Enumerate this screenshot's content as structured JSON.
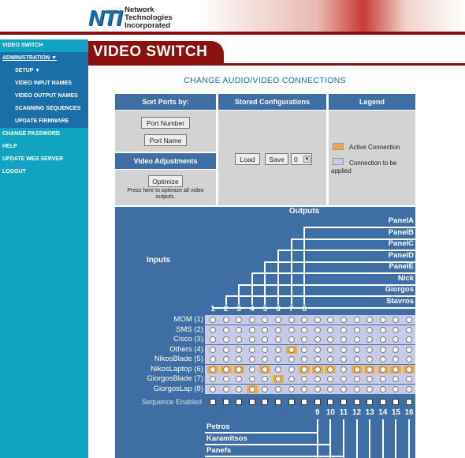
{
  "brand": {
    "logo": "NTI",
    "line1": "Network",
    "line2": "Technologies",
    "line3": "Incorporated"
  },
  "nav": [
    {
      "label": "VIDEO SWITCH",
      "type": "top"
    },
    {
      "label": "ADMINISTRATION ▼",
      "type": "admin"
    },
    {
      "label": "SETUP ▼",
      "type": "sub"
    },
    {
      "label": "VIDEO INPUT NAMES",
      "type": "sub"
    },
    {
      "label": "VIDEO OUTPUT NAMES",
      "type": "sub"
    },
    {
      "label": "SCANNING SEQUENCES",
      "type": "sub"
    },
    {
      "label": "UPDATE FIRMWARE",
      "type": "sub"
    },
    {
      "label": "CHANGE PASSWORD",
      "type": "top"
    },
    {
      "label": "HELP",
      "type": "top"
    },
    {
      "label": "UPDATE WEB SERVER",
      "type": "top"
    },
    {
      "label": "LOGOUT",
      "type": "top"
    }
  ],
  "page": {
    "title": "VIDEO SWITCH",
    "subtitle": "CHANGE AUDIO/VIDEO CONNECTIONS"
  },
  "panels": {
    "sort": {
      "header": "Sort Ports by:",
      "btn_number": "Port Number",
      "btn_name": "Port Name"
    },
    "adjust": {
      "header": "Video Adjustments",
      "btn_optimize": "Optimize",
      "note": "Press here to optimize all video outputs."
    },
    "stored": {
      "header": "Stored Configurations",
      "btn_load": "Load",
      "btn_save": "Save",
      "select_value": "0"
    },
    "legend": {
      "header": "Legend",
      "active": "Active Connection",
      "applied": "Connection to be applied"
    }
  },
  "grid": {
    "outputs_header": "Outputs",
    "inputs_header": "Inputs",
    "sequence_label": "Sequence Enabled",
    "named_outputs": [
      "PanelA",
      "PanelB",
      "PanelC",
      "PanelD",
      "PanelE",
      "Nick",
      "Giorgos",
      "Stavros"
    ],
    "top_numbers": [
      "1",
      "2",
      "3",
      "4",
      "5",
      "6",
      "7",
      "8"
    ],
    "bottom_numbers": [
      "9",
      "10",
      "11",
      "12",
      "13",
      "14",
      "15",
      "16"
    ],
    "bottom_outputs": [
      "Petros",
      "Karamitsos",
      "Panefs"
    ],
    "inputs": [
      "MOM (1)",
      "SMS (2)",
      "Cisco (3)",
      "Others (4)",
      "NikosBlade (5)",
      "NikosLaptop (6)",
      "GiorgosBlade (7)",
      "GiorgosLap (8)"
    ],
    "active_cells": [
      [
        3,
        7
      ],
      [
        5,
        1
      ],
      [
        5,
        2
      ],
      [
        5,
        3
      ],
      [
        5,
        5
      ],
      [
        5,
        8
      ],
      [
        5,
        9
      ],
      [
        5,
        10
      ],
      [
        5,
        12
      ],
      [
        5,
        13
      ],
      [
        5,
        14
      ],
      [
        5,
        15
      ],
      [
        5,
        16
      ],
      [
        6,
        6
      ],
      [
        7,
        4
      ]
    ],
    "colors": {
      "panel": "#3e6ea3",
      "active": "#f2ab3f",
      "band": "#c7cbe8",
      "accent": "#8b1010",
      "sidebar": "#11a3c2"
    }
  }
}
